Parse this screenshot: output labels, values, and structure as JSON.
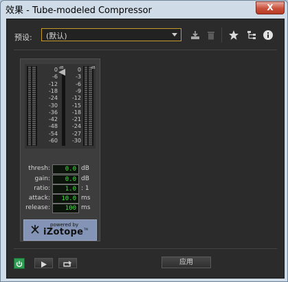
{
  "window": {
    "title": "效果 - Tube-modeled Compressor",
    "close_glyph": "X"
  },
  "toolbar": {
    "preset_label": "预设:",
    "preset_value": "(默认)",
    "icons": [
      "save-preset-icon",
      "delete-preset-icon",
      "favorite-star-icon",
      "routing-icon",
      "info-icon"
    ]
  },
  "meter": {
    "left_ticks": [
      "0",
      "-6",
      "-12",
      "-18",
      "-24",
      "-30",
      "-36",
      "-42",
      "-48",
      "-54",
      "-60"
    ],
    "left_unit": "dB",
    "right_ticks": [
      "0",
      "-3",
      "-6",
      "-9",
      "-12",
      "-15",
      "-18",
      "-21",
      "-24",
      "-27",
      "-30"
    ],
    "right_unit": "dB",
    "input_level_fraction": 0.0,
    "gain_reduction_fraction": 0.0
  },
  "params": [
    {
      "label": "thresh:",
      "value": "0.0",
      "unit": "dB"
    },
    {
      "label": "gain:",
      "value": "0.0",
      "unit": "dB"
    },
    {
      "label": "ratio:",
      "value": "1.0",
      "unit": ": 1"
    },
    {
      "label": "attack:",
      "value": "10.0",
      "unit": "ms"
    },
    {
      "label": "release:",
      "value": "100",
      "unit": "ms"
    }
  ],
  "logo": {
    "small": "powered by",
    "big": "iZotope",
    "mark": "TM"
  },
  "footer": {
    "apply_label": "应用",
    "icons": [
      "power-icon",
      "play-icon",
      "loop-icon"
    ]
  },
  "colors": {
    "accent_orange": "#c79a2b",
    "value_green": "#43e243",
    "power_green": "#2e9e52"
  }
}
